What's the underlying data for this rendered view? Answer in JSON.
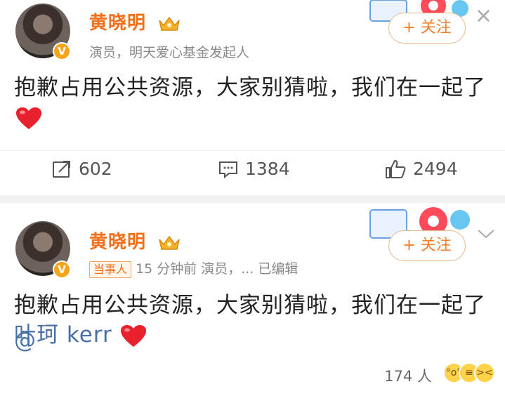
{
  "post1": {
    "author": "黄晓明",
    "verified_badge": "V",
    "bio": "演员，明天爱心基金发起人",
    "follow_label": "+ 关注",
    "text": "抱歉占用公共资源，大家别猜啦，我们在一起了",
    "actions": {
      "repost_count": "602",
      "comment_count": "1384",
      "like_count": "2494"
    }
  },
  "post2": {
    "author": "黄晓明",
    "verified_badge": "V",
    "tag": "当事人",
    "meta": "15 分钟前  演员，... 已编辑",
    "follow_label": "+ 关注",
    "text": "抱歉占用公共资源，大家别猜啦，我们在一起了",
    "mention_at": "@",
    "mention_name": "叶珂 kerr",
    "likes_text": "174 人"
  },
  "colors": {
    "name": "#f0701c",
    "follow": "#f08030",
    "heart": "#e8212c",
    "mention": "#4a6fa5"
  }
}
